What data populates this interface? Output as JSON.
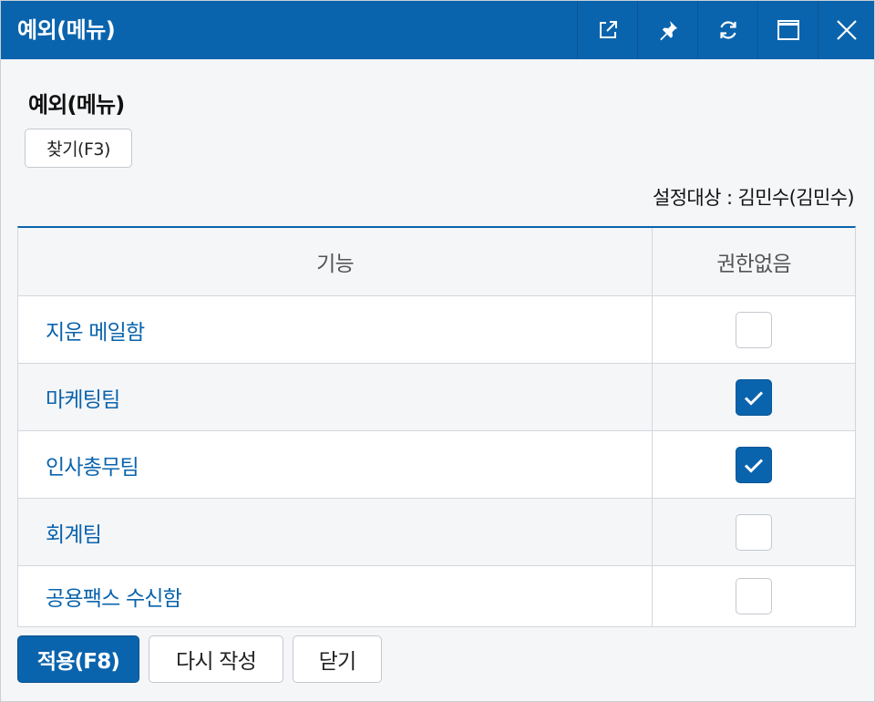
{
  "window": {
    "title": "예외(메뉴)",
    "controls": [
      {
        "name": "popout-icon"
      },
      {
        "name": "pin-icon"
      },
      {
        "name": "refresh-icon"
      },
      {
        "name": "maximize-icon"
      },
      {
        "name": "close-icon"
      }
    ]
  },
  "page": {
    "heading": "예외(메뉴)",
    "find_button": "찾기(F3)",
    "target_label": "설정대상 : 김민수(김민수)"
  },
  "table": {
    "headers": {
      "function": "기능",
      "no_permission": "권한없음"
    },
    "rows": [
      {
        "name": "지운 메일함",
        "checked": false
      },
      {
        "name": "마케팅팀",
        "checked": true
      },
      {
        "name": "인사총무팀",
        "checked": true
      },
      {
        "name": "회계팀",
        "checked": false
      },
      {
        "name": "공용팩스 수신함",
        "checked": false
      }
    ]
  },
  "footer": {
    "apply": "적용(F8)",
    "reset": "다시 작성",
    "close": "닫기"
  },
  "colors": {
    "accent": "#0a64ad",
    "background": "#f5f6f8"
  }
}
